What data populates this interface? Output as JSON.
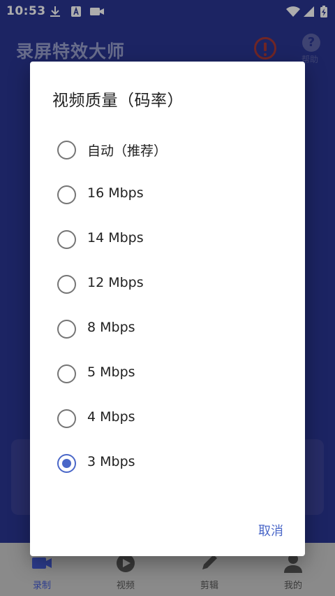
{
  "status_bar": {
    "time": "10:53"
  },
  "app": {
    "title": "录屏特效大师",
    "help_label": "帮助"
  },
  "bottom_nav": {
    "items": [
      {
        "label": "录制",
        "icon": "video-camera-icon",
        "active": true
      },
      {
        "label": "视频",
        "icon": "play-icon",
        "active": false
      },
      {
        "label": "剪辑",
        "icon": "pencil-icon",
        "active": false
      },
      {
        "label": "我的",
        "icon": "person-icon",
        "active": false
      }
    ]
  },
  "dialog": {
    "title": "视频质量（码率）",
    "options": [
      {
        "label": "自动（推荐）",
        "selected": false
      },
      {
        "label": "16 Mbps",
        "selected": false
      },
      {
        "label": "14 Mbps",
        "selected": false
      },
      {
        "label": "12 Mbps",
        "selected": false
      },
      {
        "label": "8 Mbps",
        "selected": false
      },
      {
        "label": "5 Mbps",
        "selected": false
      },
      {
        "label": "4 Mbps",
        "selected": false
      },
      {
        "label": "3 Mbps",
        "selected": true
      }
    ],
    "cancel_label": "取消"
  },
  "colors": {
    "primary": "#2a3593",
    "accent": "#4a67c8"
  }
}
